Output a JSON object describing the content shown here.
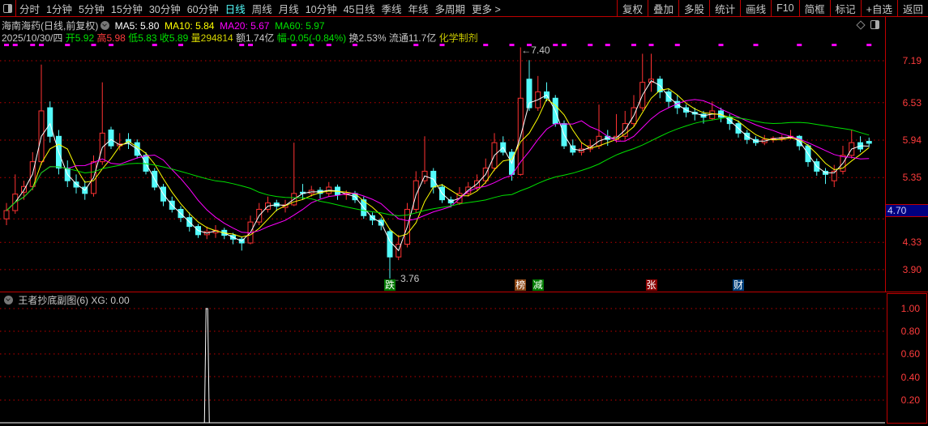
{
  "toolbar": {
    "periods": [
      "分时",
      "1分钟",
      "5分钟",
      "15分钟",
      "30分钟",
      "60分钟",
      "日线",
      "周线",
      "月线",
      "10分钟",
      "45日线",
      "季线",
      "年线",
      "多周期",
      "更多 >"
    ],
    "active": "日线",
    "buttons": [
      "复权",
      "叠加",
      "多股",
      "统计",
      "画线",
      "F10",
      "简框",
      "标记",
      "+自选",
      "返回"
    ]
  },
  "info": {
    "title": "海南海药(日线,前复权)",
    "ma5": "MA5: 5.80",
    "ma10": "MA10: 5.84",
    "ma20": "MA20: 5.67",
    "ma60": "MA60: 5.97",
    "date": "2025/10/30/四",
    "open_l": "开",
    "open": "5.92",
    "high_l": "高",
    "high": "5.98",
    "low_l": "低",
    "low": "5.83",
    "close_l": "收",
    "close": "5.89",
    "vol_l": "量",
    "vol": "294814",
    "amt": "额1.74亿",
    "chg_l": "幅",
    "chg": "-0.05(-0.84%)",
    "turn": "换2.53%",
    "float": "流通11.7亿",
    "industry": "化学制剂"
  },
  "colors": {
    "up": "#ff3232",
    "down": "#54fcfc",
    "ma5": "#ffffff",
    "ma10": "#ffff00",
    "ma20": "#ff00ff",
    "ma60": "#00e000",
    "grid": "#c00000",
    "axis_text": "#ff3c3c",
    "cursor_bg": "#000080"
  },
  "price_axis": {
    "labels": [
      "7.19",
      "6.53",
      "5.94",
      "5.35",
      "4.33",
      "3.90"
    ],
    "cursor": "4.70"
  },
  "annotations": {
    "high": "7.40",
    "low": "3.76"
  },
  "sub_panel": {
    "title": "王者抄底副图(6)",
    "xg": "XG: 0.00",
    "labels": [
      "1.00",
      "0.80",
      "0.60",
      "0.40",
      "0.20"
    ]
  },
  "chart_data": {
    "type": "candlestick",
    "y_scale": "linear",
    "ylim": [
      3.7,
      7.45
    ],
    "candles": [
      [
        4.7,
        4.95,
        4.6,
        4.83
      ],
      [
        4.83,
        5.4,
        4.78,
        5.09
      ],
      [
        5.12,
        5.3,
        5.0,
        5.21
      ],
      [
        5.21,
        5.75,
        5.15,
        5.6
      ],
      [
        5.6,
        7.13,
        5.55,
        6.4
      ],
      [
        6.45,
        6.55,
        5.9,
        6.0
      ],
      [
        6.0,
        6.1,
        5.4,
        5.5
      ],
      [
        5.5,
        5.62,
        5.2,
        5.3
      ],
      [
        5.28,
        5.4,
        5.1,
        5.2
      ],
      [
        5.2,
        5.3,
        5.0,
        5.1
      ],
      [
        5.1,
        5.7,
        5.05,
        5.6
      ],
      [
        5.6,
        6.85,
        5.55,
        6.05
      ],
      [
        6.1,
        6.15,
        5.8,
        5.85
      ],
      [
        5.85,
        6.05,
        5.78,
        5.88
      ],
      [
        5.95,
        6.05,
        5.8,
        5.9
      ],
      [
        5.9,
        5.95,
        5.65,
        5.7
      ],
      [
        5.7,
        5.75,
        5.4,
        5.45
      ],
      [
        5.45,
        5.5,
        5.15,
        5.2
      ],
      [
        5.2,
        5.25,
        4.9,
        4.98
      ],
      [
        4.98,
        5.05,
        4.8,
        4.85
      ],
      [
        4.85,
        4.9,
        4.65,
        4.72
      ],
      [
        4.72,
        4.8,
        4.5,
        4.58
      ],
      [
        4.58,
        4.62,
        4.4,
        4.45
      ],
      [
        4.45,
        4.58,
        4.38,
        4.5
      ],
      [
        4.48,
        4.6,
        4.4,
        4.52
      ],
      [
        4.52,
        4.56,
        4.38,
        4.44
      ],
      [
        4.44,
        4.48,
        4.3,
        4.38
      ],
      [
        4.38,
        4.42,
        4.2,
        4.32
      ],
      [
        4.32,
        4.75,
        4.3,
        4.65
      ],
      [
        4.65,
        4.95,
        4.6,
        4.85
      ],
      [
        4.85,
        5.05,
        4.8,
        4.95
      ],
      [
        4.95,
        5.0,
        4.82,
        4.9
      ],
      [
        4.88,
        5.0,
        4.8,
        4.92
      ],
      [
        4.92,
        5.9,
        4.9,
        5.1
      ],
      [
        5.12,
        5.25,
        5.0,
        5.1
      ],
      [
        5.1,
        5.22,
        5.05,
        5.15
      ],
      [
        5.15,
        5.2,
        5.02,
        5.1
      ],
      [
        5.1,
        5.28,
        5.05,
        5.2
      ],
      [
        5.2,
        5.24,
        5.0,
        5.08
      ],
      [
        5.08,
        5.15,
        5.0,
        5.1
      ],
      [
        5.1,
        5.14,
        4.95,
        5.0
      ],
      [
        5.0,
        5.05,
        4.7,
        4.75
      ],
      [
        4.75,
        4.8,
        4.6,
        4.68
      ],
      [
        4.68,
        4.72,
        4.52,
        4.6
      ],
      [
        4.5,
        4.55,
        3.76,
        4.1
      ],
      [
        4.1,
        4.45,
        4.05,
        4.3
      ],
      [
        4.3,
        4.95,
        4.25,
        4.85
      ],
      [
        4.85,
        5.45,
        4.8,
        5.3
      ],
      [
        5.3,
        6.0,
        5.25,
        5.45
      ],
      [
        5.45,
        5.5,
        5.1,
        5.2
      ],
      [
        5.2,
        5.25,
        4.95,
        5.0
      ],
      [
        5.0,
        5.05,
        4.88,
        4.95
      ],
      [
        4.95,
        5.2,
        4.92,
        5.1
      ],
      [
        5.1,
        5.28,
        5.05,
        5.2
      ],
      [
        5.2,
        5.4,
        5.15,
        5.3
      ],
      [
        5.3,
        5.65,
        5.25,
        5.5
      ],
      [
        5.5,
        6.05,
        5.45,
        5.9
      ],
      [
        5.9,
        6.0,
        5.7,
        5.75
      ],
      [
        5.75,
        5.8,
        5.3,
        5.4
      ],
      [
        5.4,
        7.4,
        5.38,
        6.6
      ],
      [
        6.9,
        7.2,
        6.4,
        6.45
      ],
      [
        6.45,
        6.95,
        6.4,
        6.7
      ],
      [
        6.7,
        6.85,
        6.55,
        6.6
      ],
      [
        6.6,
        6.65,
        6.15,
        6.2
      ],
      [
        6.2,
        6.25,
        5.8,
        5.85
      ],
      [
        5.85,
        5.95,
        5.7,
        5.75
      ],
      [
        5.75,
        5.9,
        5.7,
        5.8
      ],
      [
        5.8,
        5.95,
        5.75,
        5.85
      ],
      [
        5.85,
        6.5,
        5.8,
        6.0
      ],
      [
        6.0,
        6.1,
        5.85,
        5.95
      ],
      [
        5.95,
        6.35,
        5.9,
        6.0
      ],
      [
        6.0,
        6.4,
        5.95,
        6.2
      ],
      [
        6.2,
        6.65,
        6.15,
        6.45
      ],
      [
        6.45,
        7.3,
        6.4,
        6.85
      ],
      [
        6.85,
        7.3,
        6.7,
        6.9
      ],
      [
        6.9,
        6.95,
        6.6,
        6.7
      ],
      [
        6.7,
        6.75,
        6.45,
        6.55
      ],
      [
        6.55,
        6.65,
        6.35,
        6.45
      ],
      [
        6.45,
        6.5,
        6.3,
        6.38
      ],
      [
        6.38,
        6.45,
        6.25,
        6.35
      ],
      [
        6.35,
        6.4,
        6.2,
        6.3
      ],
      [
        6.28,
        6.55,
        6.25,
        6.4
      ],
      [
        6.4,
        6.45,
        6.22,
        6.3
      ],
      [
        6.3,
        6.35,
        6.1,
        6.2
      ],
      [
        6.2,
        6.25,
        5.98,
        6.05
      ],
      [
        6.05,
        6.1,
        5.88,
        5.95
      ],
      [
        5.95,
        6.0,
        5.85,
        5.9
      ],
      [
        5.9,
        6.02,
        5.86,
        5.95
      ],
      [
        5.95,
        6.0,
        5.9,
        5.97
      ],
      [
        5.97,
        6.02,
        5.92,
        5.98
      ],
      [
        5.98,
        6.1,
        5.95,
        6.0
      ],
      [
        6.0,
        6.02,
        5.78,
        5.85
      ],
      [
        5.85,
        5.88,
        5.52,
        5.6
      ],
      [
        5.6,
        5.65,
        5.38,
        5.45
      ],
      [
        5.45,
        5.5,
        5.25,
        5.4
      ],
      [
        5.3,
        5.55,
        5.2,
        5.45
      ],
      [
        5.45,
        5.85,
        5.4,
        5.7
      ],
      [
        5.7,
        6.1,
        5.65,
        5.9
      ],
      [
        5.9,
        6.0,
        5.75,
        5.8
      ],
      [
        5.92,
        5.98,
        5.83,
        5.89
      ]
    ],
    "moving_averages": [
      {
        "name": "MA5",
        "period": 5
      },
      {
        "name": "MA10",
        "period": 10
      },
      {
        "name": "MA20",
        "period": 20
      },
      {
        "name": "MA60",
        "period": 60
      }
    ],
    "signal_markers": [
      0,
      1,
      3,
      4,
      7,
      10,
      12,
      17,
      20,
      27,
      28,
      33,
      35,
      37,
      40,
      47,
      50,
      55,
      58,
      60,
      63,
      64,
      67,
      69,
      72,
      74,
      77,
      82,
      86,
      91,
      95,
      99
    ],
    "events": [
      {
        "label": "跌",
        "index": 44,
        "color": "#007a00"
      },
      {
        "label": "榜",
        "index": 59,
        "color": "#8b4513"
      },
      {
        "label": "减",
        "index": 61,
        "color": "#007a00"
      },
      {
        "label": "张",
        "index": 74,
        "color": "#8b0000"
      },
      {
        "label": "财",
        "index": 84,
        "color": "#00407a"
      }
    ],
    "xg": {
      "ylim": [
        0,
        1.05
      ],
      "signals": [
        {
          "index": 23,
          "value": 1.0
        }
      ]
    }
  }
}
